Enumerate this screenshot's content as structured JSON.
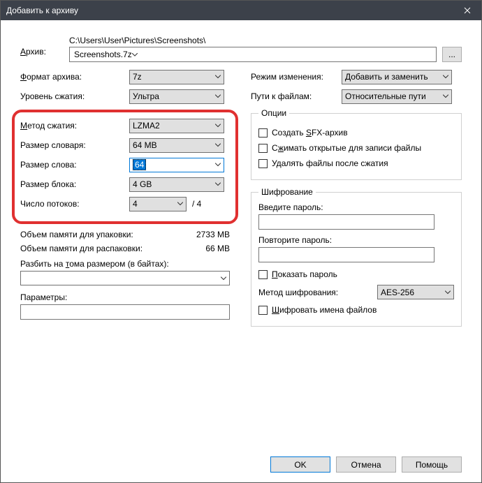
{
  "title": "Добавить к архиву",
  "archive": {
    "label": "Архив:",
    "path": "C:\\Users\\User\\Pictures\\Screenshots\\",
    "filename": "Screenshots.7z",
    "browse": "..."
  },
  "left": {
    "format_label": "Формат архива:",
    "format_value": "7z",
    "level_label": "Уровень сжатия:",
    "level_value": "Ультра",
    "method_label": "Метод сжатия:",
    "method_value": "LZMA2",
    "dict_label": "Размер словаря:",
    "dict_value": "64 MB",
    "word_label": "Размер слова:",
    "word_value": "64",
    "block_label": "Размер блока:",
    "block_value": "4 GB",
    "threads_label": "Число потоков:",
    "threads_value": "4",
    "threads_max": "/ 4",
    "mem_pack_label": "Объем памяти для упаковки:",
    "mem_pack_value": "2733 MB",
    "mem_unpack_label": "Объем памяти для распаковки:",
    "mem_unpack_value": "66 MB",
    "split_label": "Разбить на тома размером (в байтах):",
    "params_label": "Параметры:"
  },
  "right": {
    "mode_label": "Режим изменения:",
    "mode_value": "Добавить и заменить",
    "paths_label": "Пути к файлам:",
    "paths_value": "Относительные пути",
    "options_legend": "Опции",
    "opt_sfx": "Создать SFX-архив",
    "opt_shared": "Сжимать открытые для записи файлы",
    "opt_delete": "Удалять файлы после сжатия",
    "enc_legend": "Шифрование",
    "pw_label": "Введите пароль:",
    "pw2_label": "Повторите пароль:",
    "show_pw": "Показать пароль",
    "enc_method_label": "Метод шифрования:",
    "enc_method_value": "AES-256",
    "enc_names": "Шифровать имена файлов"
  },
  "buttons": {
    "ok": "OK",
    "cancel": "Отмена",
    "help": "Помощь"
  }
}
